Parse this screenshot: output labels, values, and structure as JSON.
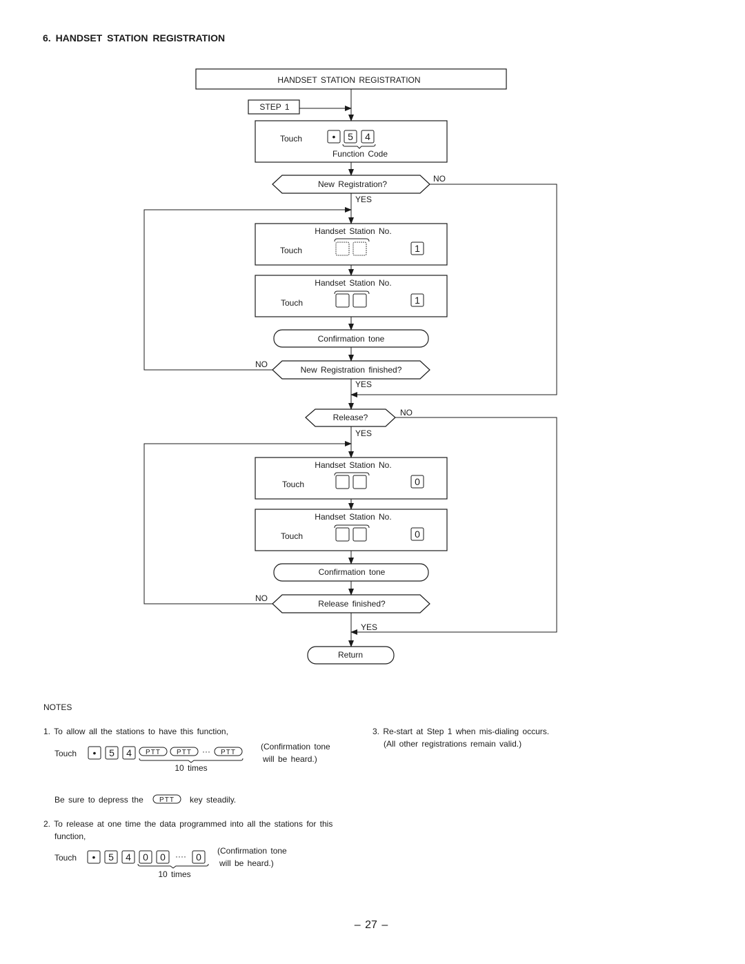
{
  "section_title": "6. HANDSET STATION REGISTRATION",
  "flow": {
    "header": "HANDSET STATION REGISTRATION",
    "step": "STEP 1",
    "touch": "Touch",
    "function_code_keys": [
      "•",
      "5",
      "4"
    ],
    "function_code_label": "Function Code",
    "new_registration": "New Registration?",
    "handset_station_no": "Handset Station No.",
    "key_1": "1",
    "key_0": "0",
    "confirmation_tone": "Confirmation tone",
    "new_registration_finished": "New Registration finished?",
    "release": "Release?",
    "release_finished": "Release finished?",
    "return": "Return",
    "yes": "YES",
    "no": "NO"
  },
  "notes": {
    "title": "NOTES",
    "note1": "1. To allow all the stations to have this function,",
    "note1_touch": "Touch",
    "note1_keys": [
      "•",
      "5",
      "4",
      "PTT",
      "PTT",
      "PTT"
    ],
    "ellipsis": "···",
    "ellipsis4": "····",
    "ten_times": "10 times",
    "confirm_line1": "(Confirmation tone",
    "confirm_line2": "will be heard.)",
    "depress_before": "Be sure to depress the",
    "depress_key": "PTT",
    "depress_after": "key steadily.",
    "note2_line1": "2. To release at one time the data programmed into all the stations for this",
    "note2_line2": "function,",
    "note2_keys": [
      "•",
      "5",
      "4",
      "0",
      "0",
      "0"
    ],
    "note3_line1": "3. Re-start at Step 1 when mis-dialing occurs.",
    "note3_line2": "(All other registrations remain valid.)"
  },
  "page_number": "– 27 –"
}
